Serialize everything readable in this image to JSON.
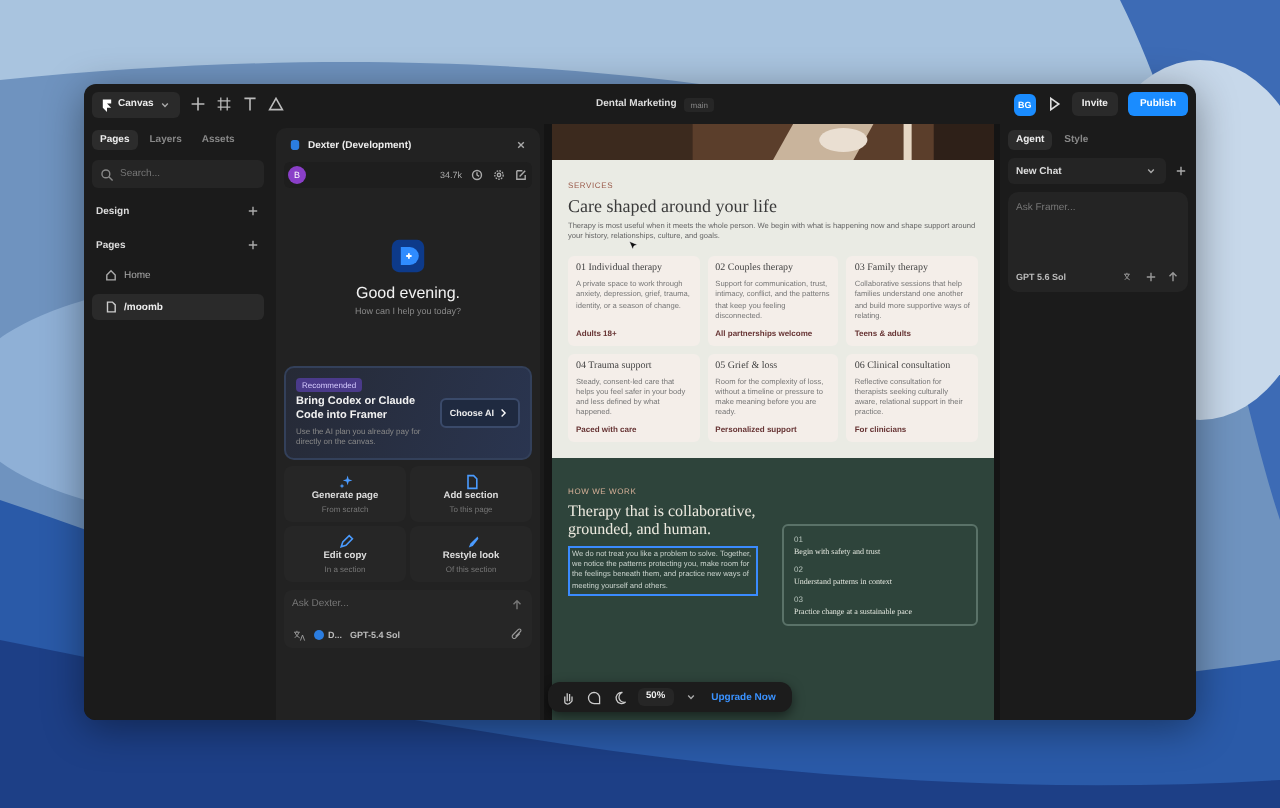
{
  "topbar": {
    "menu": "Canvas",
    "project": "Dental Marketing",
    "branch": "main",
    "avatar": "BG",
    "invite": "Invite",
    "publish": "Publish"
  },
  "left": {
    "tabs": [
      {
        "label": "Pages",
        "selected": true
      },
      {
        "label": "Layers",
        "selected": false
      },
      {
        "label": "Assets",
        "selected": false
      }
    ],
    "search": {
      "placeholder": "Search..."
    },
    "design": "Design",
    "pages_label": "Pages",
    "pages": [
      {
        "label": "Home",
        "selected": false,
        "kind": "home"
      },
      {
        "label": "/moomb",
        "selected": true,
        "kind": "page"
      }
    ]
  },
  "chat": {
    "title": "Dexter (Development)",
    "avatar": "B",
    "tokens": "34.7k",
    "greeting": "Good evening.",
    "subtitle": "How can I help you today?",
    "promo": {
      "badge": "Recommended",
      "title": "Bring Codex or Claude Code into Framer",
      "text": "Use the AI plan you already pay for directly on the canvas.",
      "button": "Choose AI"
    },
    "actions": [
      {
        "title": "Generate page",
        "sub": "From scratch",
        "kind": "sparkle"
      },
      {
        "title": "Add section",
        "sub": "To this page",
        "kind": "page"
      },
      {
        "title": "Edit copy",
        "sub": "In a section",
        "kind": "pen"
      },
      {
        "title": "Restyle look",
        "sub": "Of this section",
        "kind": "brush"
      }
    ],
    "input": {
      "placeholder": "Ask Dexter..."
    },
    "agent": "D...",
    "model": "GPT-5.4 Sol"
  },
  "site": {
    "label": "SERVICES",
    "heading": "Care shaped around your life",
    "intro": "Therapy is most useful when it meets the whole person. We begin with what is happening now and shape support around your history, relationships, culture, and goals.",
    "cards": [
      {
        "title": "01 Individual therapy",
        "text": "A private space to work through anxiety, depression, grief, trauma, identity, or a season of change.",
        "tag": "Adults 18+"
      },
      {
        "title": "02 Couples therapy",
        "text": "Support for communication, trust, intimacy, conflict, and the patterns that keep you feeling disconnected.",
        "tag": "All partnerships welcome"
      },
      {
        "title": "03 Family therapy",
        "text": "Collaborative sessions that help families understand one another and build more supportive ways of relating.",
        "tag": "Teens & adults"
      },
      {
        "title": "04 Trauma support",
        "text": "Steady, consent-led care that helps you feel safer in your body and less defined by what happened.",
        "tag": "Paced with care"
      },
      {
        "title": "05 Grief & loss",
        "text": "Room for the complexity of loss, without a timeline or pressure to make meaning before you are ready.",
        "tag": "Personalized support"
      },
      {
        "title": "06 Clinical consultation",
        "text": "Reflective consultation for therapists seeking culturally aware, relational support in their practice.",
        "tag": "For clinicians"
      }
    ],
    "dark": {
      "label": "HOW WE WORK",
      "heading": "Therapy that is collaborative, grounded, and human.",
      "text": "We do not treat you like a problem to solve. Together, we notice the patterns protecting you, make room for the feelings beneath them, and practice new ways of meeting yourself and others.",
      "steps": [
        {
          "num": "01",
          "text": "Begin with safety and trust"
        },
        {
          "num": "02",
          "text": "Understand patterns in context"
        },
        {
          "num": "03",
          "text": "Practice change at a sustainable pace"
        }
      ]
    }
  },
  "toolbar": {
    "zoom": "50%",
    "upgrade": "Upgrade Now"
  },
  "right": {
    "tabs": [
      {
        "label": "Agent",
        "selected": true
      },
      {
        "label": "Style",
        "selected": false
      }
    ],
    "chat_select": "New Chat",
    "input": {
      "placeholder": "Ask Framer..."
    },
    "model": "GPT 5.6 Sol"
  }
}
